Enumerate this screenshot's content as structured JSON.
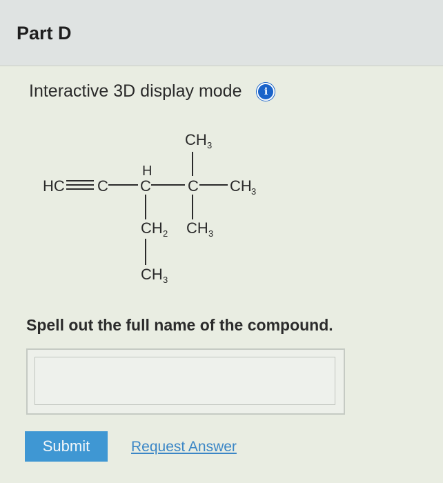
{
  "header": {
    "title": "Part D"
  },
  "mode": {
    "label": "Interactive 3D display mode",
    "info_icon": "info-icon"
  },
  "structure": {
    "atoms": {
      "ch3_top": "CH",
      "h_top": "H",
      "hc": "HC",
      "c1": "C",
      "c2": "C",
      "c3": "C",
      "ch3_right": "CH",
      "ch2": "CH",
      "ch3_mid": "CH",
      "ch3_bottom": "CH",
      "sub3": "3",
      "sub2": "2"
    }
  },
  "question": {
    "prompt": "Spell out the full name of the compound."
  },
  "answer": {
    "value": "",
    "placeholder": ""
  },
  "actions": {
    "submit_label": "Submit",
    "request_label": "Request Answer"
  },
  "colors": {
    "accent": "#3f97d3",
    "info": "#1a63c9",
    "link": "#3a86c6"
  }
}
